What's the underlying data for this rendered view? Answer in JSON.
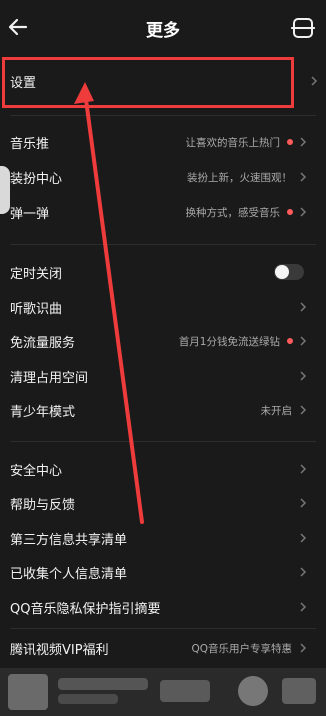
{
  "header": {
    "title": "更多"
  },
  "rows": [
    {
      "label": "设置"
    },
    {
      "label": "音乐推",
      "value": "让喜欢的音乐上热门"
    },
    {
      "label": "装扮中心",
      "value": "装扮上新，火速围观！"
    },
    {
      "label": "弹一弹",
      "value": "换种方式，感受音乐"
    },
    {
      "label": "定时关闭"
    },
    {
      "label": "听歌识曲"
    },
    {
      "label": "免流量服务",
      "value": "首月1分钱免流送绿钻"
    },
    {
      "label": "清理占用空间"
    },
    {
      "label": "青少年模式",
      "value": "未开启"
    },
    {
      "label": "安全中心"
    },
    {
      "label": "帮助与反馈"
    },
    {
      "label": "第三方信息共享清单"
    },
    {
      "label": "已收集个人信息清单"
    },
    {
      "label": "QQ音乐隐私保护指引摘要"
    },
    {
      "label": "腾讯视频VIP福利",
      "value": "QQ音乐用户专享特惠"
    }
  ],
  "timer_toggle": {
    "on": false
  },
  "colors": {
    "background": "#1a1a1a",
    "highlight": "#ee3b3b",
    "dot": "#ff5b5b"
  },
  "icons": [
    "back-arrow-icon",
    "scan-icon",
    "chevron-right-icon"
  ]
}
